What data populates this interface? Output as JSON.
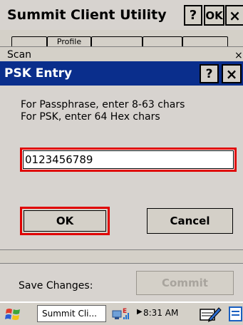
{
  "background_window": {
    "title": "Summit Client Utility",
    "help_button": "?",
    "ok_button": "OK",
    "close_button": "×",
    "tabs": [
      "",
      "Profile",
      "",
      "",
      ""
    ],
    "scan_label": "Scan",
    "scan_close": "×"
  },
  "dialog": {
    "title": "PSK Entry",
    "help_button": "?",
    "close_button": "×",
    "instruction_1": "For Passphrase, enter 8-63 chars",
    "instruction_2": "For PSK, enter 64 Hex chars",
    "input_value": "0123456789",
    "ok_label": "OK",
    "cancel_label": "Cancel"
  },
  "bottom": {
    "save_label": "Save Changes:",
    "commit_label": "Commit"
  },
  "taskbar": {
    "task_label": "Summit Cli...",
    "clock": "8:31 AM"
  },
  "colors": {
    "dialog_title_bg": "#0a2e8c",
    "highlight_red": "#e00000",
    "window_bg": "#d7d3cf"
  }
}
